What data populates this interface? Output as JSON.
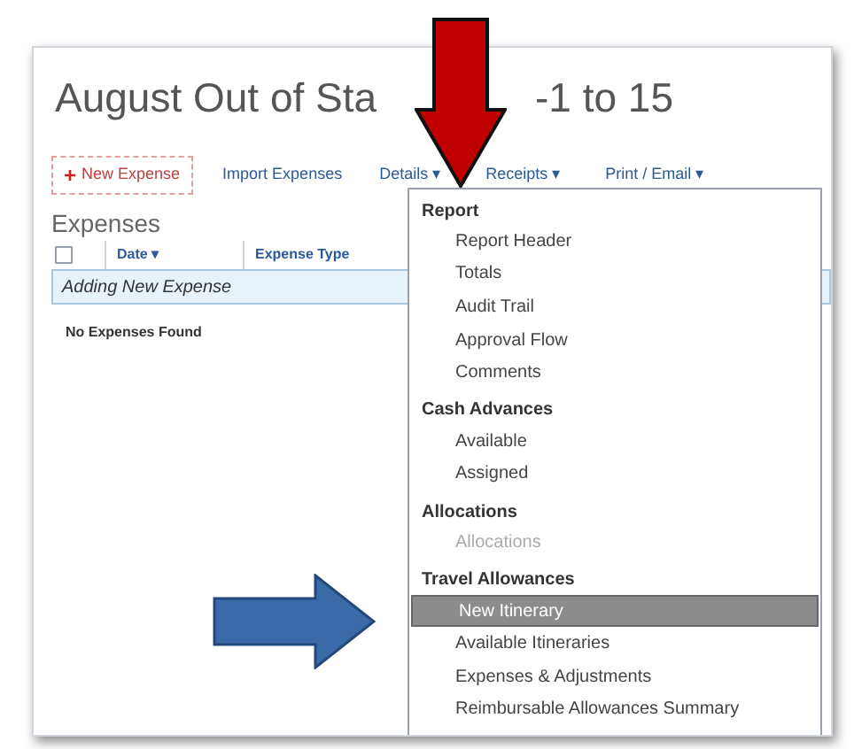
{
  "title_parts": [
    "August Out of Sta",
    "-1 to 15"
  ],
  "toolbar": [
    {
      "label": "New Expense",
      "kind": "primary",
      "icon": "+"
    },
    {
      "label": "Import Expenses",
      "kind": "link"
    },
    {
      "label": "Details",
      "kind": "menu",
      "caret": "▾"
    },
    {
      "label": "Receipts",
      "kind": "menu",
      "caret": "▾"
    },
    {
      "label": "Print / Email",
      "kind": "menu",
      "caret": "▾"
    }
  ],
  "expenses": {
    "heading": "Expenses",
    "select_all": {
      "checked": false
    },
    "columns": [
      {
        "label": "Date",
        "caret": "▾"
      },
      {
        "label": "Expense Type"
      }
    ],
    "new_row": "Adding New Expense",
    "empty_message": "No Expenses Found"
  },
  "details_menu": [
    {
      "header": "Report",
      "items": [
        {
          "label": "Report Header",
          "selected": false,
          "disabled": false
        },
        {
          "label": "Totals",
          "selected": false,
          "disabled": false
        },
        {
          "label": "Audit Trail",
          "selected": false,
          "disabled": false
        },
        {
          "label": "Approval Flow",
          "selected": false,
          "disabled": false
        },
        {
          "label": "Comments",
          "selected": false,
          "disabled": false
        }
      ]
    },
    {
      "header": "Cash Advances",
      "items": [
        {
          "label": "Available",
          "selected": false,
          "disabled": false
        },
        {
          "label": "Assigned",
          "selected": false,
          "disabled": false
        }
      ]
    },
    {
      "header": "Allocations",
      "items": [
        {
          "label": "Allocations",
          "selected": false,
          "disabled": true
        }
      ]
    },
    {
      "header": "Travel Allowances",
      "items": [
        {
          "label": "New Itinerary",
          "selected": true,
          "disabled": false
        },
        {
          "label": "Available Itineraries",
          "selected": false,
          "disabled": false
        },
        {
          "label": "Expenses & Adjustments",
          "selected": false,
          "disabled": false
        },
        {
          "label": "Reimbursable Allowances Summary",
          "selected": false,
          "disabled": false
        }
      ]
    }
  ]
}
